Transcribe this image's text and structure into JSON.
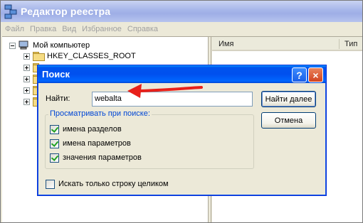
{
  "window": {
    "title": "Редактор реестра"
  },
  "menu": [
    "Файл",
    "Правка",
    "Вид",
    "Избранное",
    "Справка"
  ],
  "tree": {
    "root": "Мой компьютер",
    "items": [
      {
        "label": "HKEY_CLASSES_ROOT"
      },
      {
        "label": ""
      },
      {
        "label": ""
      },
      {
        "label": ""
      },
      {
        "label": ""
      }
    ]
  },
  "list": {
    "columns": [
      "Имя",
      "Тип"
    ]
  },
  "dialog": {
    "title": "Поиск",
    "find_label": "Найти:",
    "find_value": "webalta",
    "find_next_button": "Найти далее",
    "cancel_button": "Отмена",
    "help_button": "?",
    "close_button": "×",
    "group_title": "Просматривать при поиске:",
    "options": [
      {
        "label": "имена разделов",
        "checked": true
      },
      {
        "label": "имена параметров",
        "checked": true
      },
      {
        "label": "значения параметров",
        "checked": true
      }
    ],
    "match_whole": {
      "label": "Искать только строку целиком",
      "checked": false
    }
  },
  "colors": {
    "title_active": "#0053ee",
    "annotation_arrow": "#e8201a",
    "group_title": "#0046d5"
  },
  "icons": [
    "regedit-icon",
    "computer-icon",
    "folder-icon",
    "help-icon",
    "close-icon",
    "arrow-annotation"
  ]
}
